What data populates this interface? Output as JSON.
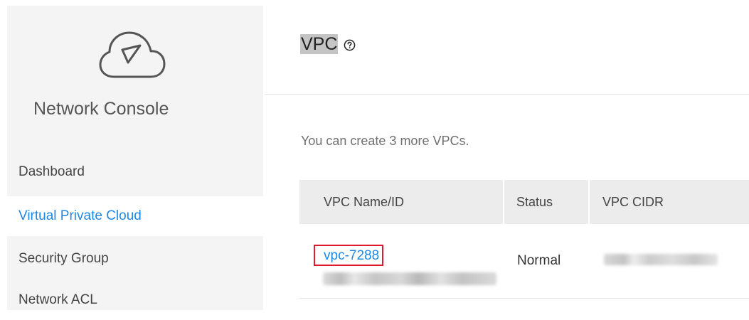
{
  "sidebar": {
    "logo_icon": "cloud-icon",
    "title": "Network Console",
    "items": [
      {
        "label": "Dashboard",
        "active": false
      },
      {
        "label": "Virtual Private Cloud",
        "active": true
      },
      {
        "label": "Security Group",
        "active": false
      },
      {
        "label": "Network ACL",
        "active": false
      }
    ]
  },
  "main": {
    "title": "VPC",
    "help_icon": "help-circle-icon",
    "quota_text": "You can create 3 more VPCs.",
    "table": {
      "columns": [
        "VPC Name/ID",
        "Status",
        "VPC CIDR"
      ],
      "rows": [
        {
          "name": "vpc-7288",
          "status": "Normal"
        }
      ]
    }
  },
  "colors": {
    "accent": "#1e88e5",
    "highlight_box": "#e0192d",
    "sidebar_bg": "#f4f4f4",
    "header_bg": "#ececec"
  }
}
